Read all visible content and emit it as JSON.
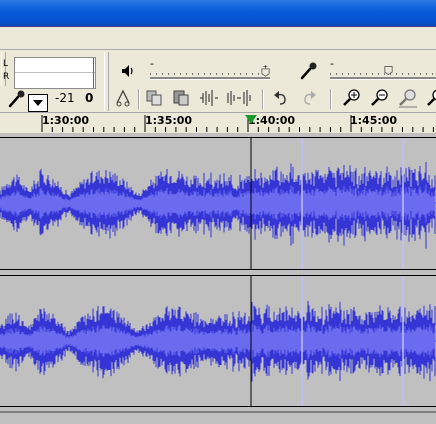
{
  "meter": {
    "left_label": "L",
    "right_label": "R"
  },
  "mixer": {
    "input_level": "-21",
    "input_value": "0"
  },
  "timeline": {
    "ticks": [
      "1:30:00",
      "1:35:00",
      "1:40:00",
      "1:45:00"
    ]
  },
  "tracks": [
    {
      "id": "track-1"
    },
    {
      "id": "track-2"
    }
  ],
  "colors": {
    "waveform": "#3535d6",
    "rms": "#6b6bf0",
    "track_bg": "#c0c0c0",
    "accent_titlebar": "#0a5ddb",
    "play_marker": "#1a9a2a"
  },
  "icons": [
    "speaker-icon",
    "microphone-icon",
    "trim-icon",
    "silence-icon",
    "copy-icon",
    "paste-icon",
    "undo-icon",
    "redo-icon",
    "zoom-in-icon",
    "zoom-out-icon",
    "fit-selection-icon"
  ]
}
